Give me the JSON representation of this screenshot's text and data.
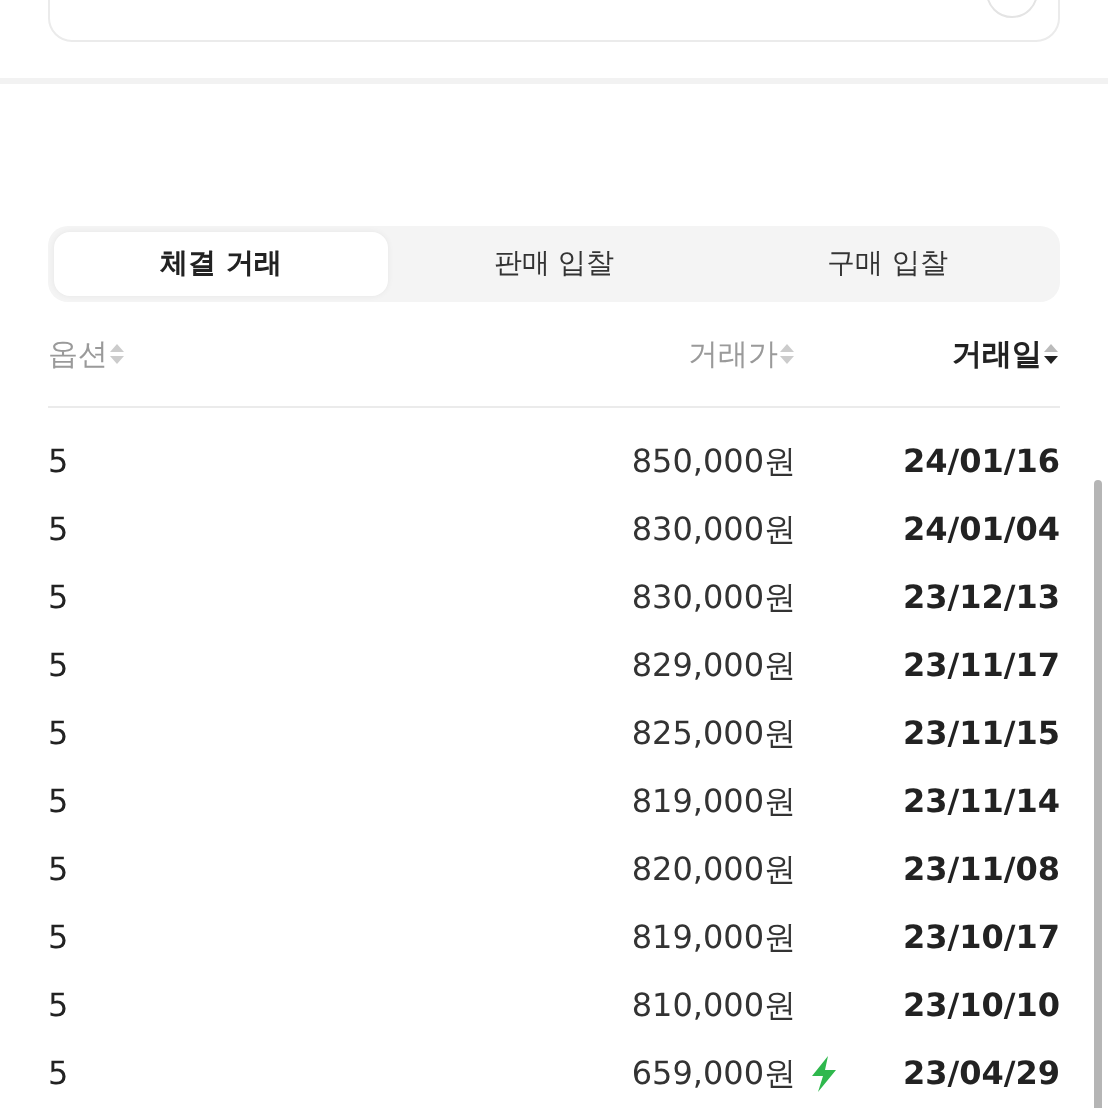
{
  "tabs": [
    {
      "label": "체결 거래",
      "selected": true
    },
    {
      "label": "판매 입찰",
      "selected": false
    },
    {
      "label": "구매 입찰",
      "selected": false
    }
  ],
  "columns": [
    {
      "label": "옵션",
      "sorted": false
    },
    {
      "label": "거래가",
      "sorted": false
    },
    {
      "label": "거래일",
      "sorted": true
    }
  ],
  "rows": [
    {
      "option": "5",
      "price": "850,000원",
      "date": "24/01/16",
      "quick": false
    },
    {
      "option": "5",
      "price": "830,000원",
      "date": "24/01/04",
      "quick": false
    },
    {
      "option": "5",
      "price": "830,000원",
      "date": "23/12/13",
      "quick": false
    },
    {
      "option": "5",
      "price": "829,000원",
      "date": "23/11/17",
      "quick": false
    },
    {
      "option": "5",
      "price": "825,000원",
      "date": "23/11/15",
      "quick": false
    },
    {
      "option": "5",
      "price": "819,000원",
      "date": "23/11/14",
      "quick": false
    },
    {
      "option": "5",
      "price": "820,000원",
      "date": "23/11/08",
      "quick": false
    },
    {
      "option": "5",
      "price": "819,000원",
      "date": "23/10/17",
      "quick": false
    },
    {
      "option": "5",
      "price": "810,000원",
      "date": "23/10/10",
      "quick": false
    },
    {
      "option": "5",
      "price": "659,000원",
      "date": "23/04/29",
      "quick": true
    }
  ]
}
